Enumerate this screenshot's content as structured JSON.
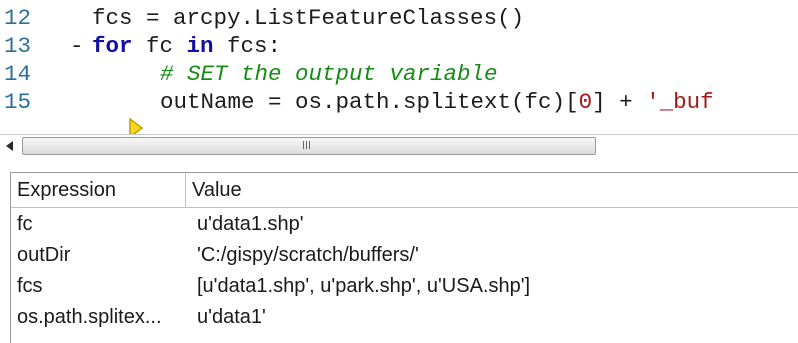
{
  "editor": {
    "lines": [
      {
        "number": "12",
        "text_parts": [
          "fcs = arcpy.ListFeatureClasses()"
        ]
      },
      {
        "number": "13",
        "fold": "-",
        "keyword1": "for",
        "middle": " fc ",
        "keyword2": "in",
        "rest": " fcs:"
      },
      {
        "number": "14",
        "comment": "# SET the output variable"
      },
      {
        "number": "15",
        "current": true,
        "pre": "outName = os.path.splitext(fc)[",
        "index": "0",
        "post": "] + ",
        "string": "'_buf"
      }
    ]
  },
  "scrollbar": {
    "left_arrow": "◀"
  },
  "watch": {
    "columns": [
      "Expression",
      "Value"
    ],
    "rows": [
      {
        "expression": "fc",
        "value": "u'data1.shp'"
      },
      {
        "expression": "outDir",
        "value": "'C:/gispy/scratch/buffers/'"
      },
      {
        "expression": "fcs",
        "value": "[u'data1.shp', u'park.shp', u'USA.shp']"
      },
      {
        "expression": "os.path.splitex...",
        "value": "u'data1'"
      }
    ]
  },
  "colors": {
    "keyword": "#1010a8",
    "comment": "#168b16",
    "string": "#a01a1a",
    "line_number": "#2b6f9e",
    "current_line_arrow": "#f2c200"
  }
}
